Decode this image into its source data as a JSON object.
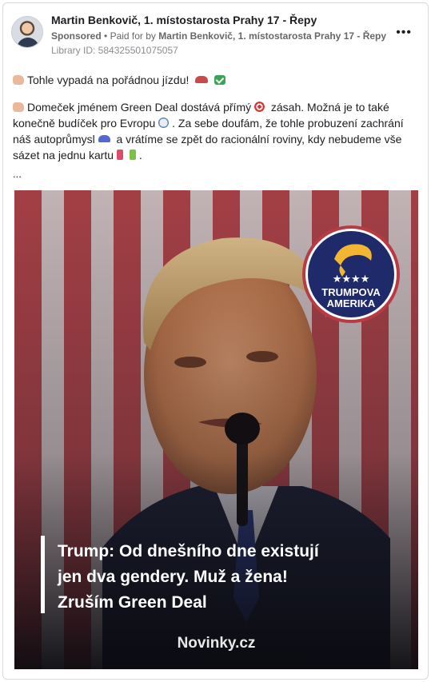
{
  "post": {
    "author": "Martin Benkovič, 1. místostarosta Prahy 17 - Řepy",
    "sponsored_label": "Sponsored",
    "paid_for_prefix": "Paid for by",
    "paid_for_name": "Martin Benkovič, 1. místostarosta Prahy 17 - Řepy",
    "library_id": "Library ID: 584325501075057",
    "more_label": "•••",
    "text_line1": "Tohle vypadá na pořádnou jízdu!",
    "text_p2_a": "Domeček jménem Green Deal dostává přímý",
    "text_p2_b": "zásah. Možná je to také konečně budíček pro Evropu",
    "text_p2_c": ". Za sebe doufám, že tohle probuzení zachrání náš autoprůmysl",
    "text_p2_d": "a vrátíme se zpět do racionální roviny, kdy nebudeme vše sázet na jednu kartu",
    "text_p2_e": ".",
    "ellipsis": "..."
  },
  "media": {
    "caption_lines": [
      "Trump: Od dnešního dne existují",
      "jen dva gendery. Muž a žena!",
      "Zruším Green Deal"
    ],
    "source": "Novinky.cz",
    "badge_line1": "TRUMPOVA",
    "badge_line2": "AMERIKA",
    "badge_stars": "★★★★"
  },
  "colors": {
    "badge_navy": "#1f2a6b",
    "badge_gold": "#f2b632",
    "badge_border": "#b93a44",
    "caption_text": "#ffffff"
  },
  "icons": [
    "avatar",
    "more-icon",
    "raised-hand-icon",
    "car-icon",
    "check-icon",
    "target-icon",
    "alarm-clock-icon",
    "electric-car-icon",
    "battery-icon"
  ]
}
